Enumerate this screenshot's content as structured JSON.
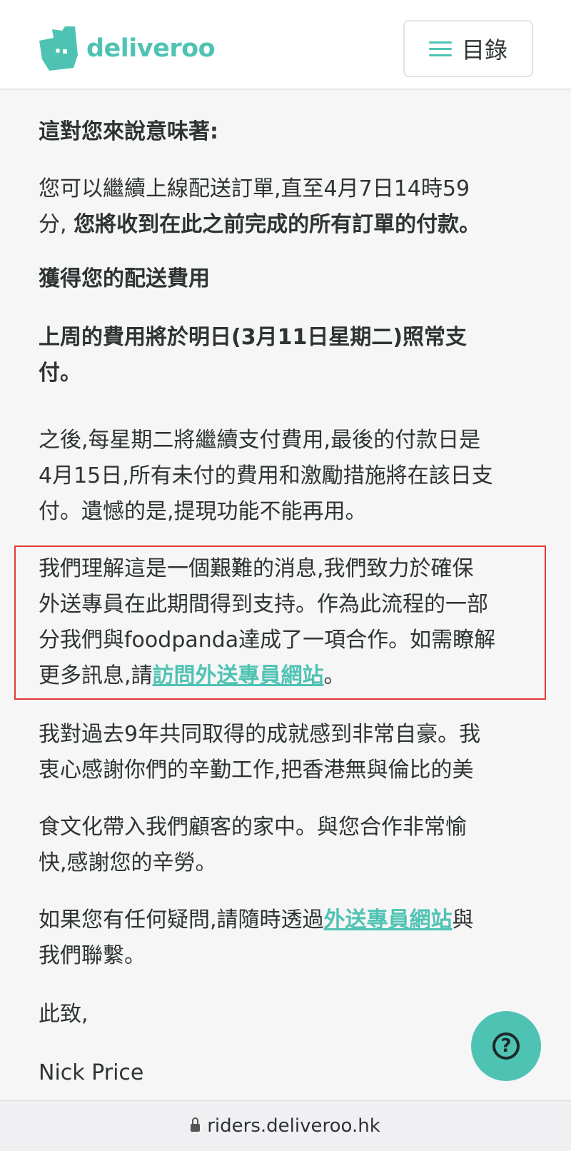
{
  "header": {
    "brand": "deliveroo",
    "menu_label": "目錄"
  },
  "article": {
    "p1": "這對您來說意味著:",
    "p2_line1": "您可以繼續上線配送訂單,直至4月7日14時59",
    "p2_line2_plain": "分, ",
    "p2_line2_bold": "您將收到在此之前完成的所有訂單的付款。",
    "p3": "獲得您的配送費用",
    "p4_line1": "上周的費用將於明日(3月11日星期二)照常支",
    "p4_line2": "付。",
    "p5_line1": "之後,每星期二將繼續支付費用,最後的付款日是",
    "p5_line2": "4月15日,所有未付的費用和激勵措施將在該日支",
    "p5_line3": "付。遺憾的是,提現功能不能再用。",
    "p6_line1": "我們理解這是一個艱難的消息,我們致力於確保",
    "p6_line2": "外送專員在此期間得到支持。作為此流程的一部",
    "p6_line3": "分我們與foodpanda達成了一項合作。如需瞭解",
    "p6_line4_prefix": "更多訊息,請",
    "p6_link": "訪問外送專員網站",
    "p6_line4_suffix": "。",
    "p7_line1": "我對過去9年共同取得的成就感到非常自豪。我",
    "p7_line2": "衷心感謝你們的辛勤工作,把香港無與倫比的美",
    "p8_line1": "食文化帶入我們顧客的家中。與您合作非常愉",
    "p8_line2": "快,感謝您的辛勞。",
    "p9_line1_prefix": "如果您有任何疑問,請隨時透過",
    "p9_link": "外送專員網站",
    "p9_line1_suffix": "與",
    "p9_line2": "我們聯繫。",
    "p10": "此致,",
    "p11": "Nick Price"
  },
  "browser": {
    "url": "riders.deliveroo.hk"
  },
  "icons": {
    "logo": "deliveroo-kangaroo-icon",
    "menu": "hamburger-icon",
    "help": "question-mark-icon",
    "lock": "lock-icon"
  },
  "colors": {
    "brand": "#4fc3b3",
    "highlight_border": "#e53935"
  }
}
